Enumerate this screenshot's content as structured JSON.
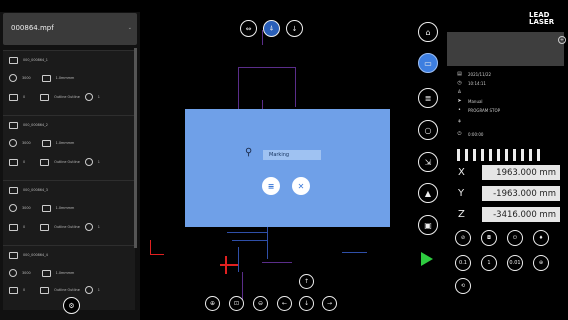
{
  "file": {
    "name": "000864.mpf",
    "chevron": "⌄"
  },
  "layers": [
    {
      "name": "000_000864_1",
      "speed": "3000",
      "size": "1.0mmmm",
      "count": "0",
      "outline": "Outline\nOutline",
      "times": "1"
    },
    {
      "name": "000_000864_2",
      "speed": "3000",
      "size": "1.0mmmm",
      "count": "0",
      "outline": "Outline\nOutline",
      "times": "1"
    },
    {
      "name": "000_000864_3",
      "speed": "3000",
      "size": "1.0mmmm",
      "count": "0",
      "outline": "Outline\nOutline",
      "times": "1"
    },
    {
      "name": "000_000864_4",
      "speed": "3000",
      "size": "1.0mmmm",
      "count": "0",
      "outline": "Outline\nOutline",
      "times": "1"
    }
  ],
  "dialog": {
    "field": "Marking",
    "btn_ok": "≡",
    "btn_close": "✕"
  },
  "top_tools": {
    "t1": "⇔",
    "t2": "⍋",
    "t3": "↓"
  },
  "bottom_tools": {
    "up": "↑",
    "b1": "⊕",
    "b2": "⊡",
    "b3": "⊖",
    "left": "←",
    "down": "↓",
    "right": "→"
  },
  "info": {
    "date": "2021/11/22",
    "time": "10:14:11",
    "mode": "Manual",
    "program": "PROGRAM STOP",
    "duration": "0:00:00"
  },
  "logo": {
    "line1": "LEAD",
    "line2": "LASER"
  },
  "coords": [
    {
      "axis": "X",
      "value": "1963.000 mm"
    },
    {
      "axis": "Y",
      "value": "-1963.000 mm"
    },
    {
      "axis": "Z",
      "value": "-3416.000 mm"
    }
  ],
  "steps": {
    "s1": "0.1",
    "s2": "1",
    "s3": "0.01"
  },
  "colors": {
    "accent": "#3d7ee0",
    "dialog": "#6fa0e8",
    "play": "#2ecc40"
  }
}
